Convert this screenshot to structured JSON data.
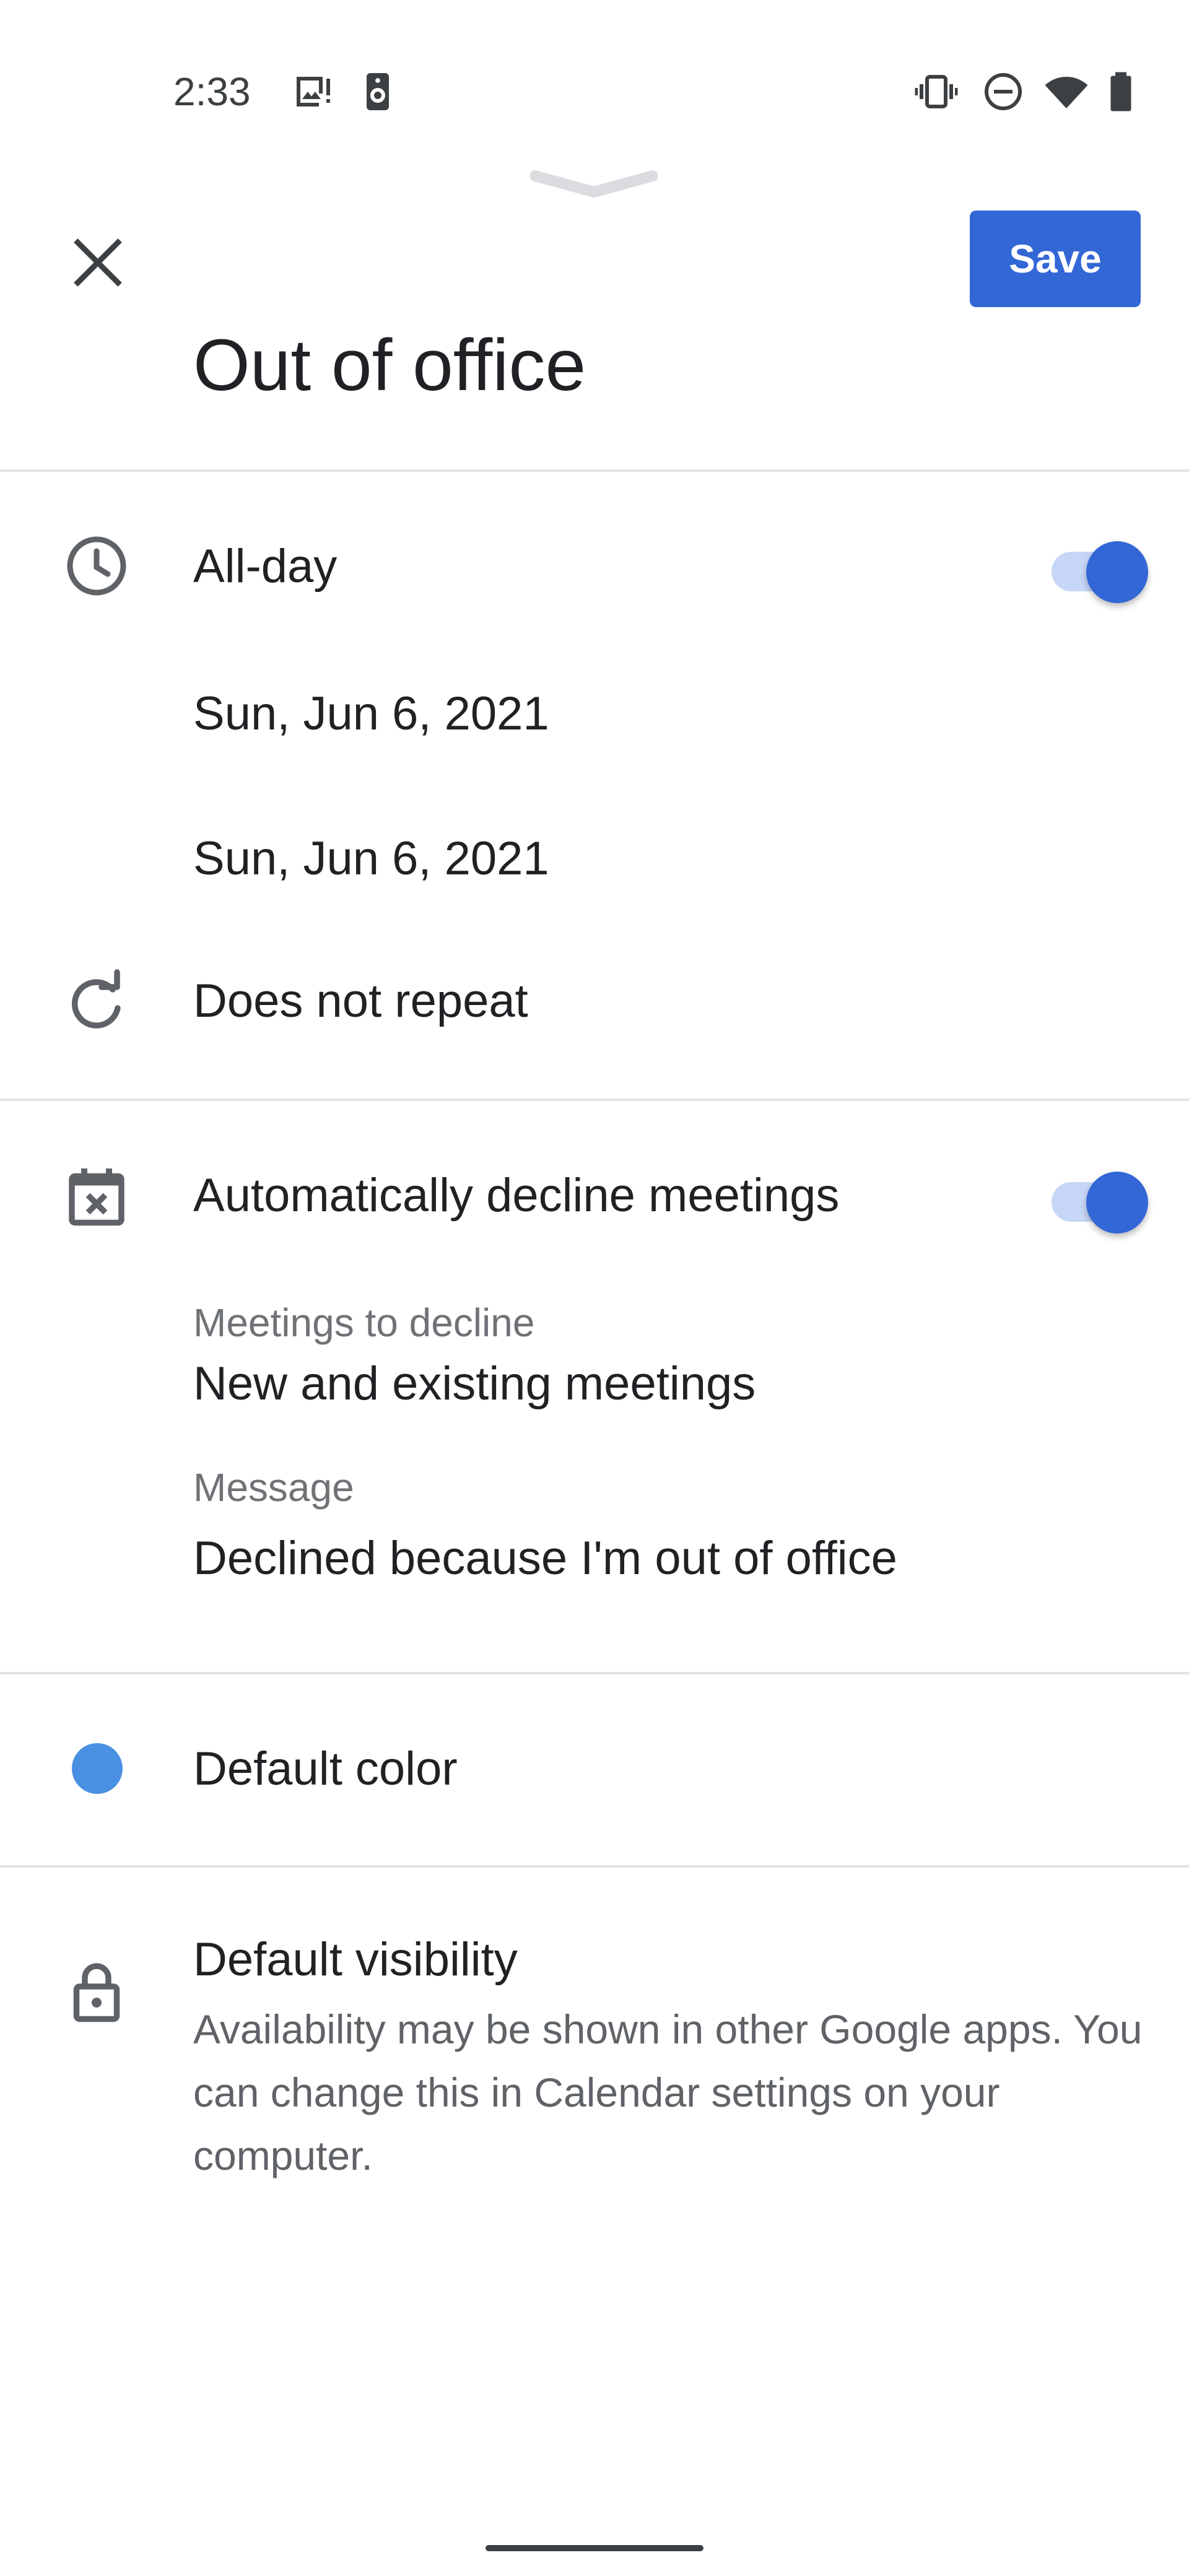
{
  "status_bar": {
    "time": "2:33",
    "left_icons": [
      "image-icon",
      "speaker-icon"
    ],
    "right_icons": [
      "vibrate-icon",
      "do-not-disturb-icon",
      "wifi-icon",
      "battery-icon"
    ]
  },
  "header": {
    "close_icon": "close-icon",
    "save_label": "Save",
    "title": "Out of office"
  },
  "time_section": {
    "all_day_label": "All-day",
    "all_day_on": true,
    "start_date": "Sun, Jun 6, 2021",
    "end_date": "Sun, Jun 6, 2021",
    "repeat_label": "Does not repeat"
  },
  "decline_section": {
    "label": "Automatically decline meetings",
    "enabled": true,
    "meetings_to_decline_label": "Meetings to decline",
    "meetings_to_decline_value": "New and existing meetings",
    "message_label": "Message",
    "message_value": "Declined because I'm out of office"
  },
  "color_section": {
    "label": "Default color",
    "color": "#4a90e2"
  },
  "visibility_section": {
    "label": "Default visibility",
    "description": "Availability may be shown in other Google apps. You can change this in Calendar settings on your computer."
  },
  "colors": {
    "accent": "#3367d6",
    "toggle_track": "#c6d6f6",
    "divider": "#e3e3e3"
  }
}
